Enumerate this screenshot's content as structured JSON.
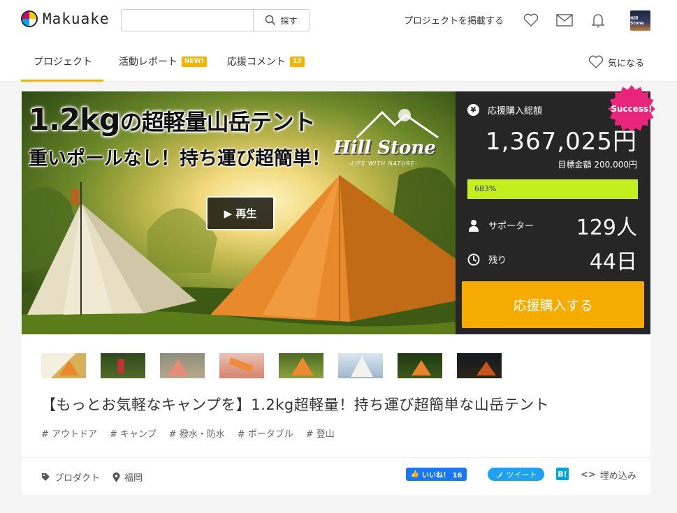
{
  "header": {
    "logo_text": "Makuake",
    "search_placeholder": "",
    "search_button": "探す",
    "post_project": "プロジェクトを掲載する",
    "avatar_text": "Hill Stone"
  },
  "tabs": {
    "project": "プロジェクト",
    "report": "活動レポート",
    "report_badge": "NEW!",
    "comments": "応援コメント",
    "comments_badge": "13",
    "favorite": "気になる"
  },
  "hero": {
    "title_num": "1.2kg",
    "title_rest": "の超軽量山岳テント",
    "subtitle": "重いポールなし！持ち運び超簡単！",
    "brand": "Hill Stone",
    "brand_tagline": "-LIFE WITH NATURE-",
    "play_button": "▶ 再生"
  },
  "stats": {
    "success_badge": "Success!",
    "total_label": "応援購入総額",
    "total_amount": "1,367,025円",
    "goal_text": "目標金額 200,000円",
    "progress_label": "683%",
    "progress_fraction": 1.0,
    "supporters_label": "サポーター",
    "supporters_value": "129人",
    "remaining_label": "残り",
    "remaining_value": "44日",
    "cta": "応援購入する",
    "colors": {
      "panel": "#262626",
      "progress": "#c3f01c",
      "cta": "#f5ab00",
      "success": "#e8257b"
    }
  },
  "project": {
    "title": "【もっとお気軽なキャンプを】1.2kg超軽量！持ち運び超簡単な山岳テント",
    "tags": [
      "# アウトドア",
      "# キャンプ",
      "# 撥水・防水",
      "# ポータブル",
      "# 登山"
    ],
    "category": "プロダクト",
    "location": "福岡"
  },
  "share": {
    "like": "いいね！ 16",
    "tweet": "ツイート",
    "hatena": "B!",
    "embed_code": "<>",
    "embed_label": "埋め込み"
  },
  "icons": {
    "search": "search-icon",
    "heart": "heart-icon",
    "mail": "mail-icon",
    "bell": "bell-icon",
    "yen": "yen-icon",
    "person": "person-icon",
    "clock": "clock-icon",
    "tag": "tag-icon",
    "pin": "location-pin-icon"
  }
}
